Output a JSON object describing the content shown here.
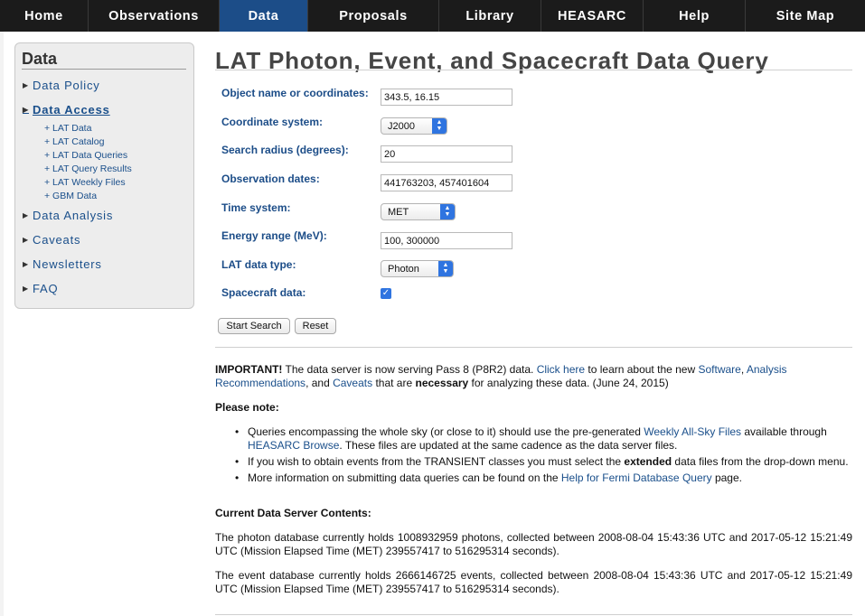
{
  "nav": {
    "items": [
      "Home",
      "Observations",
      "Data",
      "Proposals",
      "Library",
      "HEASARC",
      "Help",
      "Site Map"
    ],
    "active": "Data"
  },
  "sidebar": {
    "title": "Data",
    "data_policy": "Data Policy",
    "data_access": "Data Access",
    "sub": [
      "+ LAT Data",
      "+ LAT Catalog",
      "+ LAT Data Queries",
      "+ LAT Query Results",
      "+ LAT Weekly Files",
      "+ GBM Data"
    ],
    "data_analysis": "Data Analysis",
    "caveats": "Caveats",
    "newsletters": "Newsletters",
    "faq": "FAQ"
  },
  "main": {
    "title": "LAT Photon, Event, and Spacecraft Data Query"
  },
  "form": {
    "object_label": "Object name or coordinates:",
    "object_value": "343.5, 16.15",
    "coord_label": "Coordinate system:",
    "coord_value": "J2000",
    "radius_label": "Search radius (degrees):",
    "radius_value": "20",
    "dates_label": "Observation dates:",
    "dates_value": "441763203, 457401604",
    "timesys_label": "Time system:",
    "timesys_value": "MET",
    "energy_label": "Energy range (MeV):",
    "energy_value": "100, 300000",
    "datatype_label": "LAT data type:",
    "datatype_value": "Photon",
    "spacecraft_label": "Spacecraft data:",
    "spacecraft_checked": true,
    "start_button": "Start Search",
    "reset_button": "Reset"
  },
  "notice": {
    "important": "IMPORTANT!",
    "t1": " The data server is now serving Pass 8 (P8R2) data. ",
    "click_here": "Click here",
    "t2": " to learn about the new ",
    "software": "Software",
    "t3": ", ",
    "analysis": "Analysis Recommendations",
    "t4": ", and ",
    "caveats": "Caveats",
    "t5": " that are ",
    "necessary": "necessary",
    "t6": " for analyzing these data. (June 24, 2015)"
  },
  "please_note": {
    "heading": "Please note:",
    "b1_t1": "Queries encompassing the whole sky (or close to it) should use the pre-generated ",
    "b1_link1": "Weekly All-Sky Files",
    "b1_t2": " available through ",
    "b1_link2": "HEASARC Browse",
    "b1_t3": ". These files are updated at the same cadence as the data server files.",
    "b2_t1": "If you wish to obtain events from the TRANSIENT classes you must select the ",
    "b2_bold": "extended",
    "b2_t2": " data files from the drop-down menu.",
    "b3_t1": "More information on submitting data queries can be found on the ",
    "b3_link": "Help for Fermi Database Query",
    "b3_t2": " page."
  },
  "contents": {
    "heading": "Current Data Server Contents:",
    "photon": "The photon database currently holds 1008932959 photons, collected between 2008-08-04 15:43:36 UTC and 2017-05-12 15:21:49 UTC (Mission Elapsed Time (MET) 239557417 to 516295314 seconds).",
    "event": "The event database currently holds 2666146725 events, collected between 2008-08-04 15:43:36 UTC and 2017-05-12 15:21:49 UTC (Mission Elapsed Time (MET) 239557417 to 516295314 seconds)."
  }
}
